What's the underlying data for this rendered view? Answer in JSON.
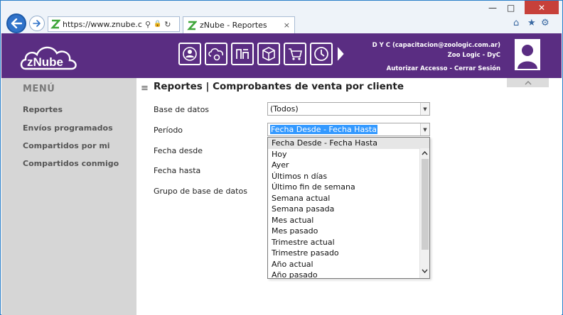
{
  "browser": {
    "url": "https://www.znube.com...",
    "tab_title": "zNube - Reportes",
    "tab_close": "×",
    "home_icon": "⌂",
    "star_icon": "★",
    "gear_icon": "⚙",
    "minimize": "—",
    "maximize": "□",
    "close": "✕",
    "search_glyph": "⚲",
    "lock_glyph": "🔒",
    "refresh_glyph": "↻"
  },
  "header": {
    "brand": "zNube",
    "user_line1": "D Y C (capacitacion@zoologic.com.ar)",
    "user_line2": "Zoo Logic - DyC",
    "authorize_link": "Autorizar Accesso",
    "separator": " - ",
    "logout_link": "Cerrar Sesión",
    "toolbar_icons": [
      "user-gear-icon",
      "cloud-gear-icon",
      "report-icon",
      "box-icon",
      "cart-icon",
      "clock-icon",
      "chevron-right-icon"
    ]
  },
  "sidebar": {
    "title": "MENÚ",
    "items": [
      {
        "label": "Reportes"
      },
      {
        "label": "Envíos programados"
      },
      {
        "label": "Compartidos por mi"
      },
      {
        "label": "Compartidos conmigo"
      }
    ]
  },
  "main": {
    "hamburger": "≡",
    "title": "Reportes | Comprobantes de venta por cliente",
    "fields": {
      "base_label": "Base de datos",
      "base_value": "(Todos)",
      "period_label": "Período",
      "period_value": "Fecha Desde - Fecha Hasta",
      "fecha_desde_label": "Fecha desde",
      "fecha_hasta_label": "Fecha hasta",
      "grupo_label": "Grupo de base de datos"
    },
    "period_options": [
      "Fecha Desde - Fecha Hasta",
      "Hoy",
      "Ayer",
      "Últimos n días",
      "Último fin de semana",
      "Semana actual",
      "Semana pasada",
      "Mes actual",
      "Mes pasado",
      "Trimestre actual",
      "Trimestre pasado",
      "Año actual",
      "Año pasado"
    ]
  },
  "colors": {
    "header_purple": "#5a2d82",
    "sidebar_gray": "#d6d6d6",
    "selection_blue": "#3399ff",
    "browser_blue": "#2f72c9"
  }
}
